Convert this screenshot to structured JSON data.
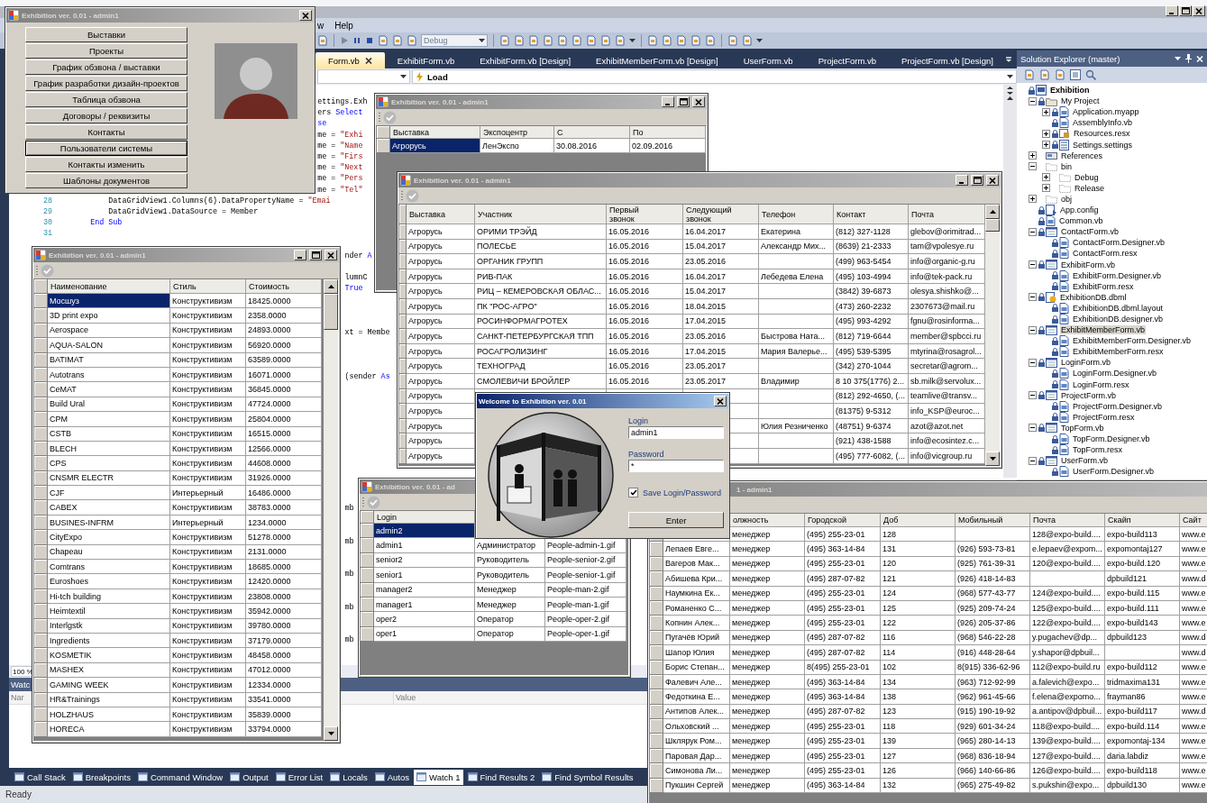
{
  "ide": {
    "menu": [
      "w",
      "Help"
    ],
    "build_config": "Debug",
    "tabs": [
      {
        "label": "Form.vb",
        "selected": true
      },
      {
        "label": "ExhibitForm.vb",
        "selected": false
      },
      {
        "label": "ExhibitForm.vb [Design]",
        "selected": false
      },
      {
        "label": "ExhibitMemberForm.vb [Design]",
        "selected": false
      },
      {
        "label": "UserForm.vb",
        "selected": false
      },
      {
        "label": "ProjectForm.vb",
        "selected": false
      },
      {
        "label": "ProjectForm.vb [Design]",
        "selected": false
      }
    ],
    "member_dropdown": "Load",
    "code_lines": [
      {
        "segments": [
          {
            "kind": "plain",
            "text": "                                                      ettings.Exh"
          }
        ]
      },
      {
        "segments": [
          {
            "kind": "plain",
            "text": "                                                      ers "
          },
          {
            "kind": "keyword",
            "text": "Select"
          }
        ]
      },
      {
        "segments": [
          {
            "kind": "keyword",
            "text": "                                                      se"
          }
        ]
      },
      {
        "segments": [
          {
            "kind": "plain",
            "text": "                                                      me = "
          },
          {
            "kind": "string",
            "text": "\"Exhi"
          }
        ]
      },
      {
        "segments": [
          {
            "kind": "plain",
            "text": "                                                      me = "
          },
          {
            "kind": "string",
            "text": "\"Name"
          }
        ]
      },
      {
        "segments": [
          {
            "kind": "plain",
            "text": "                                                      me = "
          },
          {
            "kind": "string",
            "text": "\"Firs"
          }
        ]
      },
      {
        "segments": [
          {
            "kind": "plain",
            "text": "                                                      me = "
          },
          {
            "kind": "string",
            "text": "\"Next"
          }
        ]
      },
      {
        "segments": [
          {
            "kind": "plain",
            "text": "                                                      me = "
          },
          {
            "kind": "string",
            "text": "\"Pers"
          }
        ]
      },
      {
        "segments": [
          {
            "kind": "plain",
            "text": "                                                      me = "
          },
          {
            "kind": "string",
            "text": "\"Tel\""
          }
        ]
      },
      {
        "number": "28",
        "segments": [
          {
            "kind": "plain",
            "text": "        DataGridView1.Columns(6).DataPropertyName = "
          },
          {
            "kind": "string",
            "text": "\"Emai"
          }
        ]
      },
      {
        "number": "29",
        "segments": [
          {
            "kind": "plain",
            "text": "        DataGridView1.DataSource = Member"
          }
        ]
      },
      {
        "number": "30",
        "segments": [
          {
            "kind": "keyword",
            "text": "    End Sub"
          }
        ]
      },
      {
        "number": "31"
      },
      {
        "segments": [
          {
            "kind": "plain",
            "text": "                                                            nder "
          },
          {
            "kind": "keyword",
            "text": "A"
          }
        ]
      },
      {
        "segments": [
          {
            "kind": "plain",
            "text": "                                                            lumnC"
          }
        ]
      },
      {
        "segments": [
          {
            "kind": "keyword",
            "text": "                                                            True"
          }
        ]
      },
      {
        "segments": [
          {
            "kind": "plain",
            "text": "                                                            xt = Membe"
          }
        ]
      },
      {
        "segments": [
          {
            "kind": "plain",
            "text": "                                                            (sender "
          },
          {
            "kind": "keyword",
            "text": "As"
          }
        ]
      },
      {
        "segments": [
          {
            "kind": "plain",
            "text": "                                                            mb"
          }
        ]
      },
      {
        "segments": [
          {
            "kind": "plain",
            "text": "                                                            mb"
          }
        ]
      },
      {
        "segments": [
          {
            "kind": "plain",
            "text": "                                                            mb"
          }
        ]
      },
      {
        "segments": [
          {
            "kind": "plain",
            "text": "                                                            mb"
          }
        ]
      },
      {
        "segments": [
          {
            "kind": "plain",
            "text": "                                                            mb"
          }
        ]
      }
    ],
    "zoom": "100 %",
    "watch": {
      "title": "Watc",
      "columns": [
        "Nar",
        "Value"
      ]
    },
    "bottom_tabs": [
      {
        "label": "Call Stack",
        "selected": false
      },
      {
        "label": "Breakpoints",
        "selected": false
      },
      {
        "label": "Command Window",
        "selected": false
      },
      {
        "label": "Output",
        "selected": false
      },
      {
        "label": "Error List",
        "selected": false
      },
      {
        "label": "Locals",
        "selected": false
      },
      {
        "label": "Autos",
        "selected": false
      },
      {
        "label": "Watch 1",
        "selected": true
      },
      {
        "label": "Find Results 2",
        "selected": false
      },
      {
        "label": "Find Symbol Results",
        "selected": false
      }
    ],
    "status": "Ready"
  },
  "solution_explorer": {
    "title": "Solution Explorer (master)",
    "tree": [
      {
        "label": "Exhibition",
        "kind": "project",
        "locked": true,
        "selected": false,
        "children": [
          {
            "label": "My Project",
            "kind": "folder",
            "locked": true,
            "expanded": true,
            "selected": false,
            "children": [
              {
                "label": "Application.myapp",
                "kind": "vb",
                "locked": true,
                "expanded": false,
                "selected": false
              },
              {
                "label": "AssemblyInfo.vb",
                "kind": "vb",
                "locked": true,
                "selected": false
              },
              {
                "label": "Resources.resx",
                "kind": "resx",
                "locked": true,
                "expanded": false,
                "selected": false
              },
              {
                "label": "Settings.settings",
                "kind": "settings",
                "locked": true,
                "expanded": false,
                "selected": false
              }
            ]
          },
          {
            "label": "References",
            "kind": "references",
            "locked": false,
            "expanded": false,
            "selected": false
          },
          {
            "label": "bin",
            "kind": "empty_folder",
            "locked": false,
            "expanded": true,
            "selected": false,
            "children": [
              {
                "label": "Debug",
                "kind": "empty_folder",
                "locked": false,
                "expanded": false,
                "selected": false
              },
              {
                "label": "Release",
                "kind": "empty_folder",
                "locked": false,
                "expanded": false,
                "selected": false
              }
            ]
          },
          {
            "label": "obj",
            "kind": "empty_folder",
            "locked": false,
            "expanded": false,
            "selected": false
          },
          {
            "label": "App.config",
            "kind": "config",
            "locked": true,
            "selected": false
          },
          {
            "label": "Common.vb",
            "kind": "vb",
            "locked": true,
            "selected": false
          },
          {
            "label": "ContactForm.vb",
            "kind": "form",
            "locked": true,
            "expanded": true,
            "selected": false,
            "children": [
              {
                "label": "ContactForm.Designer.vb",
                "kind": "vb",
                "locked": true,
                "selected": false
              },
              {
                "label": "ContactForm.resx",
                "kind": "vb",
                "locked": true,
                "selected": false
              }
            ]
          },
          {
            "label": "ExhibitForm.vb",
            "kind": "form",
            "locked": true,
            "expanded": true,
            "selected": false,
            "children": [
              {
                "label": "ExhibitForm.Designer.vb",
                "kind": "vb",
                "locked": true,
                "selected": false
              },
              {
                "label": "ExhibitForm.resx",
                "kind": "vb",
                "locked": true,
                "selected": false
              }
            ]
          },
          {
            "label": "ExhibitionDB.dbml",
            "kind": "dbml",
            "locked": true,
            "expanded": true,
            "selected": false,
            "children": [
              {
                "label": "ExhibitionDB.dbml.layout",
                "kind": "vb",
                "locked": true,
                "selected": false
              },
              {
                "label": "ExhibitionDB.designer.vb",
                "kind": "vb",
                "locked": true,
                "selected": false
              }
            ]
          },
          {
            "label": "ExhibitMemberForm.vb",
            "kind": "form",
            "locked": true,
            "expanded": true,
            "selected": true,
            "children": [
              {
                "label": "ExhibitMemberForm.Designer.vb",
                "kind": "vb",
                "locked": true,
                "selected": false
              },
              {
                "label": "ExhibitMemberForm.resx",
                "kind": "vb",
                "locked": true,
                "selected": false
              }
            ]
          },
          {
            "label": "LoginForm.vb",
            "kind": "form",
            "locked": true,
            "expanded": true,
            "selected": false,
            "children": [
              {
                "label": "LoginForm.Designer.vb",
                "kind": "vb",
                "locked": true,
                "selected": false
              },
              {
                "label": "LoginForm.resx",
                "kind": "vb",
                "locked": true,
                "selected": false
              }
            ]
          },
          {
            "label": "ProjectForm.vb",
            "kind": "form",
            "locked": true,
            "expanded": true,
            "selected": false,
            "children": [
              {
                "label": "ProjectForm.Designer.vb",
                "kind": "vb",
                "locked": true,
                "selected": false
              },
              {
                "label": "ProjectForm.resx",
                "kind": "vb",
                "locked": true,
                "selected": false
              }
            ]
          },
          {
            "label": "TopForm.vb",
            "kind": "form",
            "locked": true,
            "expanded": true,
            "selected": false,
            "children": [
              {
                "label": "TopForm.Designer.vb",
                "kind": "vb",
                "locked": true,
                "selected": false
              },
              {
                "label": "TopForm.resx",
                "kind": "vb",
                "locked": true,
                "selected": false
              }
            ]
          },
          {
            "label": "UserForm.vb",
            "kind": "form",
            "locked": true,
            "expanded": true,
            "selected": false,
            "children": [
              {
                "label": "UserForm.Designer.vb",
                "kind": "vb",
                "locked": true,
                "selected": false
              }
            ]
          }
        ]
      }
    ]
  },
  "menu_window": {
    "title": "Exhibition ver. 0.01 - admin1",
    "buttons": [
      {
        "label": "Выставки",
        "focused": false
      },
      {
        "label": "Проекты",
        "focused": false
      },
      {
        "label": "График обзвона / выставки",
        "focused": false
      },
      {
        "label": "График разработки дизайн-проектов",
        "focused": false
      },
      {
        "label": "Таблица обзвона",
        "focused": false
      },
      {
        "label": "Договоры / реквизиты",
        "focused": false
      },
      {
        "label": "Контакты",
        "focused": false
      },
      {
        "label": "Пользователи системы",
        "focused": true
      },
      {
        "label": "Контакты изменить",
        "focused": false
      },
      {
        "label": "Шаблоны документов",
        "focused": false
      }
    ]
  },
  "exhibitions_window": {
    "title": "Exhibition ver. 0.01 - admin1",
    "columns": [
      "Выставка",
      "Экспоцентр",
      "С",
      "По"
    ],
    "rows": [
      {
        "selected": true,
        "cells": [
          "Агрорусь",
          "ЛенЭкспо",
          "30.08.2016",
          "02.09.2016"
        ]
      }
    ]
  },
  "participants_window": {
    "title": "Exhibition ver. 0.01 - admin1",
    "columns": [
      "Выставка",
      "Участник",
      "Первый звонок",
      "Следующий звонок",
      "Телефон",
      "Контакт",
      "Почта"
    ],
    "rows": [
      {
        "cells": [
          "Агрорусь",
          "ОРИМИ ТРЭЙД",
          "16.05.2016",
          "16.04.2017",
          "Екатерина",
          "(812) 327-1128",
          "glebov@orimitrad..."
        ]
      },
      {
        "cells": [
          "Агрорусь",
          "ПОЛЕСЬЕ",
          "16.05.2016",
          "15.04.2017",
          "Александр Мих...",
          "(8639) 21-2333",
          "tam@vpolesye.ru"
        ]
      },
      {
        "cells": [
          "Агрорусь",
          "ОРГАНИК ГРУПП",
          "16.05.2016",
          "23.05.2016",
          null,
          "(499) 963-5454",
          "info@organic-g.ru"
        ]
      },
      {
        "cells": [
          "Агрорусь",
          "РИВ-ПАК",
          "16.05.2016",
          "16.04.2017",
          "Лебедева Елена",
          "(495) 103-4994",
          "info@tek-pack.ru"
        ]
      },
      {
        "cells": [
          "Агрорусь",
          "РИЦ – КЕМЕРОВСКАЯ ОБЛАС...",
          "16.05.2016",
          "15.04.2017",
          null,
          "(3842) 39-6873",
          "olesya.shishko@..."
        ]
      },
      {
        "cells": [
          "Агрорусь",
          "ПК \"РОС-АГРО\"",
          "16.05.2016",
          "18.04.2015",
          null,
          "(473) 260-2232",
          "2307673@mail.ru"
        ]
      },
      {
        "cells": [
          "Агрорусь",
          "РОСИНФОРМАГРОТЕХ",
          "16.05.2016",
          "17.04.2015",
          null,
          "(495) 993-4292",
          "fgnu@rosinforma..."
        ]
      },
      {
        "cells": [
          "Агрорусь",
          "САНКТ-ПЕТЕРБУРГСКАЯ ТПП",
          "16.05.2016",
          "23.05.2016",
          "Быстрова Ната...",
          "(812) 719-6644",
          "member@spbcci.ru"
        ]
      },
      {
        "cells": [
          "Агрорусь",
          "РОСАГРОЛИЗИНГ",
          "16.05.2016",
          "17.04.2015",
          "Мария Валерье...",
          "(495) 539-5395",
          "mtyrina@rosagrol..."
        ]
      },
      {
        "cells": [
          "Агрорусь",
          "ТЕХНОГРАД",
          "16.05.2016",
          "23.05.2017",
          null,
          "(342) 270-1044",
          "secretar@agrom..."
        ]
      },
      {
        "cells": [
          "Агрорусь",
          "СМОЛЕВИЧИ БРОЙЛЕР",
          "16.05.2016",
          "23.05.2017",
          "Владимир",
          "8 10 375(1776) 2...",
          "sb.milk@servolux..."
        ]
      },
      {
        "cells": [
          "Агрорусь",
          null,
          null,
          null,
          null,
          "(812) 292-4650, (...",
          "teamlive@transv..."
        ]
      },
      {
        "cells": [
          "Агрорусь",
          null,
          null,
          null,
          null,
          "(81375) 9-5312",
          "info_KSP@euroc..."
        ]
      },
      {
        "cells": [
          "Агрорусь",
          null,
          null,
          null,
          "Юлия Резниченко",
          "(48751) 9-6374",
          "azot@azot.net"
        ]
      },
      {
        "cells": [
          "Агрорусь",
          null,
          null,
          null,
          null,
          "(921) 438-1588",
          "info@ecosintez.c..."
        ]
      },
      {
        "cells": [
          "Агрорусь",
          null,
          null,
          null,
          null,
          "(495) 777-6082, (...",
          "info@vicgroup.ru"
        ]
      }
    ]
  },
  "designs_window": {
    "title": "Exhibition ver. 0.01 - admin1",
    "columns": [
      "Наименование",
      "Стиль",
      "Стоимость"
    ],
    "rows": [
      {
        "selected": true,
        "cells": [
          "Мосшуз",
          "Конструктивизм",
          "18425.0000"
        ]
      },
      {
        "selected": false,
        "cells": [
          "3D print expo",
          "Конструктивизм",
          "2358.0000"
        ]
      },
      {
        "selected": false,
        "cells": [
          "Aerospace",
          "Конструктивизм",
          "24893.0000"
        ]
      },
      {
        "selected": false,
        "cells": [
          "AQUA-SALON",
          "Конструктивизм",
          "56920.0000"
        ]
      },
      {
        "selected": false,
        "cells": [
          "BATIMAT",
          "Конструктивизм",
          "63589.0000"
        ]
      },
      {
        "selected": false,
        "cells": [
          "Autotrans",
          "Конструктивизм",
          "16071.0000"
        ]
      },
      {
        "selected": false,
        "cells": [
          "CeMAT",
          "Конструктивизм",
          "36845.0000"
        ]
      },
      {
        "selected": false,
        "cells": [
          "Build Ural",
          "Конструктивизм",
          "47724.0000"
        ]
      },
      {
        "selected": false,
        "cells": [
          "CPM",
          "Конструктивизм",
          "25804.0000"
        ]
      },
      {
        "selected": false,
        "cells": [
          "CSTB",
          "Конструктивизм",
          "16515.0000"
        ]
      },
      {
        "selected": false,
        "cells": [
          "BLECH",
          "Конструктивизм",
          "12566.0000"
        ]
      },
      {
        "selected": false,
        "cells": [
          "CPS",
          "Конструктивизм",
          "44608.0000"
        ]
      },
      {
        "selected": false,
        "cells": [
          "CNSMR ELECTR",
          "Конструктивизм",
          "31926.0000"
        ]
      },
      {
        "selected": false,
        "cells": [
          "CJF",
          "Интерьерный",
          "16486.0000"
        ]
      },
      {
        "selected": false,
        "cells": [
          "CABEX",
          "Конструктивизм",
          "38783.0000"
        ]
      },
      {
        "selected": false,
        "cells": [
          "BUSINES-INFRM",
          "Интерьерный",
          "1234.0000"
        ]
      },
      {
        "selected": false,
        "cells": [
          "CityExpo",
          "Конструктивизм",
          "51278.0000"
        ]
      },
      {
        "selected": false,
        "cells": [
          "Chapeau",
          "Конструктивизм",
          "2131.0000"
        ]
      },
      {
        "selected": false,
        "cells": [
          "Comtrans",
          "Конструктивизм",
          "18685.0000"
        ]
      },
      {
        "selected": false,
        "cells": [
          "Euroshoes",
          "Конструктивизм",
          "12420.0000"
        ]
      },
      {
        "selected": false,
        "cells": [
          "Hi-tch building",
          "Конструктивизм",
          "23808.0000"
        ]
      },
      {
        "selected": false,
        "cells": [
          "Heimtextil",
          "Конструктивизм",
          "35942.0000"
        ]
      },
      {
        "selected": false,
        "cells": [
          "Interlgstk",
          "Конструктивизм",
          "39780.0000"
        ]
      },
      {
        "selected": false,
        "cells": [
          "Ingredients",
          "Конструктивизм",
          "37179.0000"
        ]
      },
      {
        "selected": false,
        "cells": [
          "KOSMETIK",
          "Конструктивизм",
          "48458.0000"
        ]
      },
      {
        "selected": false,
        "cells": [
          "MASHEX",
          "Конструктивизм",
          "47012.0000"
        ]
      },
      {
        "selected": false,
        "cells": [
          "GAMING WEEK",
          "Конструктивизм",
          "12334.0000"
        ]
      },
      {
        "selected": false,
        "cells": [
          "HR&Trainings",
          "Конструктивизм",
          "33541.0000"
        ]
      },
      {
        "selected": false,
        "cells": [
          "HOLZHAUS",
          "Конструктивизм",
          "35839.0000"
        ]
      },
      {
        "selected": false,
        "cells": [
          "HORECA",
          "Конструктивизм",
          "33794.0000"
        ]
      }
    ]
  },
  "users_window": {
    "title": "Exhibition ver. 0.01 - ad",
    "columns": [
      "Login",
      null,
      null
    ],
    "rows": [
      {
        "selected": true,
        "cells": [
          "admin2",
          null,
          null
        ]
      },
      {
        "selected": false,
        "cells": [
          "admin1",
          "Администратор",
          "People-admin-1.gif"
        ]
      },
      {
        "selected": false,
        "cells": [
          "senior2",
          "Руководитель",
          "People-senior-2.gif"
        ]
      },
      {
        "selected": false,
        "cells": [
          "senior1",
          "Руководитель",
          "People-senior-1.gif"
        ]
      },
      {
        "selected": false,
        "cells": [
          "manager2",
          "Менеджер",
          "People-man-2.gif"
        ]
      },
      {
        "selected": false,
        "cells": [
          "manager1",
          "Менеджер",
          "People-man-1.gif"
        ]
      },
      {
        "selected": false,
        "cells": [
          "oper2",
          "Оператор",
          "People-oper-2.gif"
        ]
      },
      {
        "selected": false,
        "cells": [
          "oper1",
          "Оператор",
          "People-oper-1.gif"
        ]
      }
    ]
  },
  "contacts_window": {
    "title": "1 - admin1",
    "columns": [
      null,
      "олжность",
      "Городской",
      "Доб",
      "Мобильный",
      "Почта",
      "Скайп",
      "Сайт"
    ],
    "rows": [
      {
        "cells": [
          null,
          "менеджер",
          "(495) 255-23-01",
          "128",
          null,
          "128@expo-build....",
          "expo-build113",
          "www.e"
        ]
      },
      {
        "cells": [
          "Лепаев Евге...",
          "менеджер",
          "(495) 363-14-84",
          "131",
          "(926) 593-73-81",
          "e.lepaev@expom...",
          "expomontaj127",
          "www.e"
        ]
      },
      {
        "cells": [
          "Вагеров Мак...",
          "менеджер",
          "(495) 255-23-01",
          "120",
          "(925) 761-39-31",
          "120@expo-build....",
          "expo-build.120",
          "www.e"
        ]
      },
      {
        "cells": [
          "Абишева Кри...",
          "менеджер",
          "(495) 287-07-82",
          "121",
          "(926) 418-14-83",
          null,
          "dpbuild121",
          "www.d"
        ]
      },
      {
        "cells": [
          "Наумкина Ек...",
          "менеджер",
          "(495) 255-23-01",
          "124",
          "(968) 577-43-77",
          "124@expo-build....",
          "expo-build.115",
          "www.e"
        ]
      },
      {
        "cells": [
          "Романенко С...",
          "менеджер",
          "(495) 255-23-01",
          "125",
          "(925) 209-74-24",
          "125@expo-build....",
          "expo-build.111",
          "www.e"
        ]
      },
      {
        "cells": [
          "Копнин Алек...",
          "менеджер",
          "(495) 255-23-01",
          "122",
          "(926) 205-37-86",
          "122@expo-build....",
          "expo-build143",
          "www.e"
        ]
      },
      {
        "cells": [
          "Пугачёв Юрий",
          "менеджер",
          "(495) 287-07-82",
          "116",
          "(968) 546-22-28",
          "y.pugachev@dp...",
          "dpbuild123",
          "www.d"
        ]
      },
      {
        "cells": [
          "Шапор Юлия",
          "менеджер",
          "(495) 287-07-82",
          "114",
          "(916) 448-28-64",
          "y.shapor@dpbuil...",
          null,
          "www.d"
        ]
      },
      {
        "cells": [
          "Борис Степан...",
          "менеджер",
          "8(495) 255-23-01",
          "102",
          "8(915) 336-62-96",
          "112@expo-build.ru",
          "expo-build112",
          "www.e"
        ]
      },
      {
        "cells": [
          "Фалевич Але...",
          "менеджер",
          "(495) 363-14-84",
          "134",
          "(963) 712-92-99",
          "a.falevich@expo...",
          "tridmaxima131",
          "www.e"
        ]
      },
      {
        "cells": [
          "Федоткина Е...",
          "менеджер",
          "(495) 363-14-84",
          "138",
          "(962) 961-45-66",
          "f.elena@expomo...",
          "frayman86",
          "www.e"
        ]
      },
      {
        "cells": [
          "Антипов Алек...",
          "менеджер",
          "(495) 287-07-82",
          "123",
          "(915) 190-19-92",
          "a.antipov@dpbuil...",
          "expo-build117",
          "www.d"
        ]
      },
      {
        "cells": [
          "Ольховский ...",
          "менеджер",
          "(495) 255-23-01",
          "118",
          "(929) 601-34-24",
          "118@expo-build....",
          "expo-build.114",
          "www.e"
        ]
      },
      {
        "cells": [
          "Шклярук Ром...",
          "менеджер",
          "(495) 255-23-01",
          "139",
          "(965) 280-14-13",
          "139@expo-build....",
          "expomontaj-134",
          "www.e"
        ]
      },
      {
        "cells": [
          "Паровая Дар...",
          "менеджер",
          "(495) 255-23-01",
          "127",
          "(968) 836-18-94",
          "127@expo-build....",
          "daria.labdiz",
          "www.e"
        ]
      },
      {
        "cells": [
          "Симонова Ли...",
          "менеджер",
          "(495) 255-23-01",
          "126",
          "(966) 140-66-86",
          "126@expo-build....",
          "expo-build118",
          "www.e"
        ]
      },
      {
        "cells": [
          "Пукшин Сергей",
          "менеджер",
          "(495) 363-14-84",
          "132",
          "(965) 275-49-82",
          "s.pukshin@expo...",
          "dpbuild130",
          "www.e"
        ]
      }
    ]
  },
  "login_dialog": {
    "title": "Welcome to Exhibition ver. 0.01",
    "login_label": "Login",
    "login_value": "admin1",
    "password_label": "Password",
    "password_value": "*",
    "save_checkbox": {
      "label": "Save Login/Password",
      "checked": true
    },
    "enter_button": "Enter"
  }
}
